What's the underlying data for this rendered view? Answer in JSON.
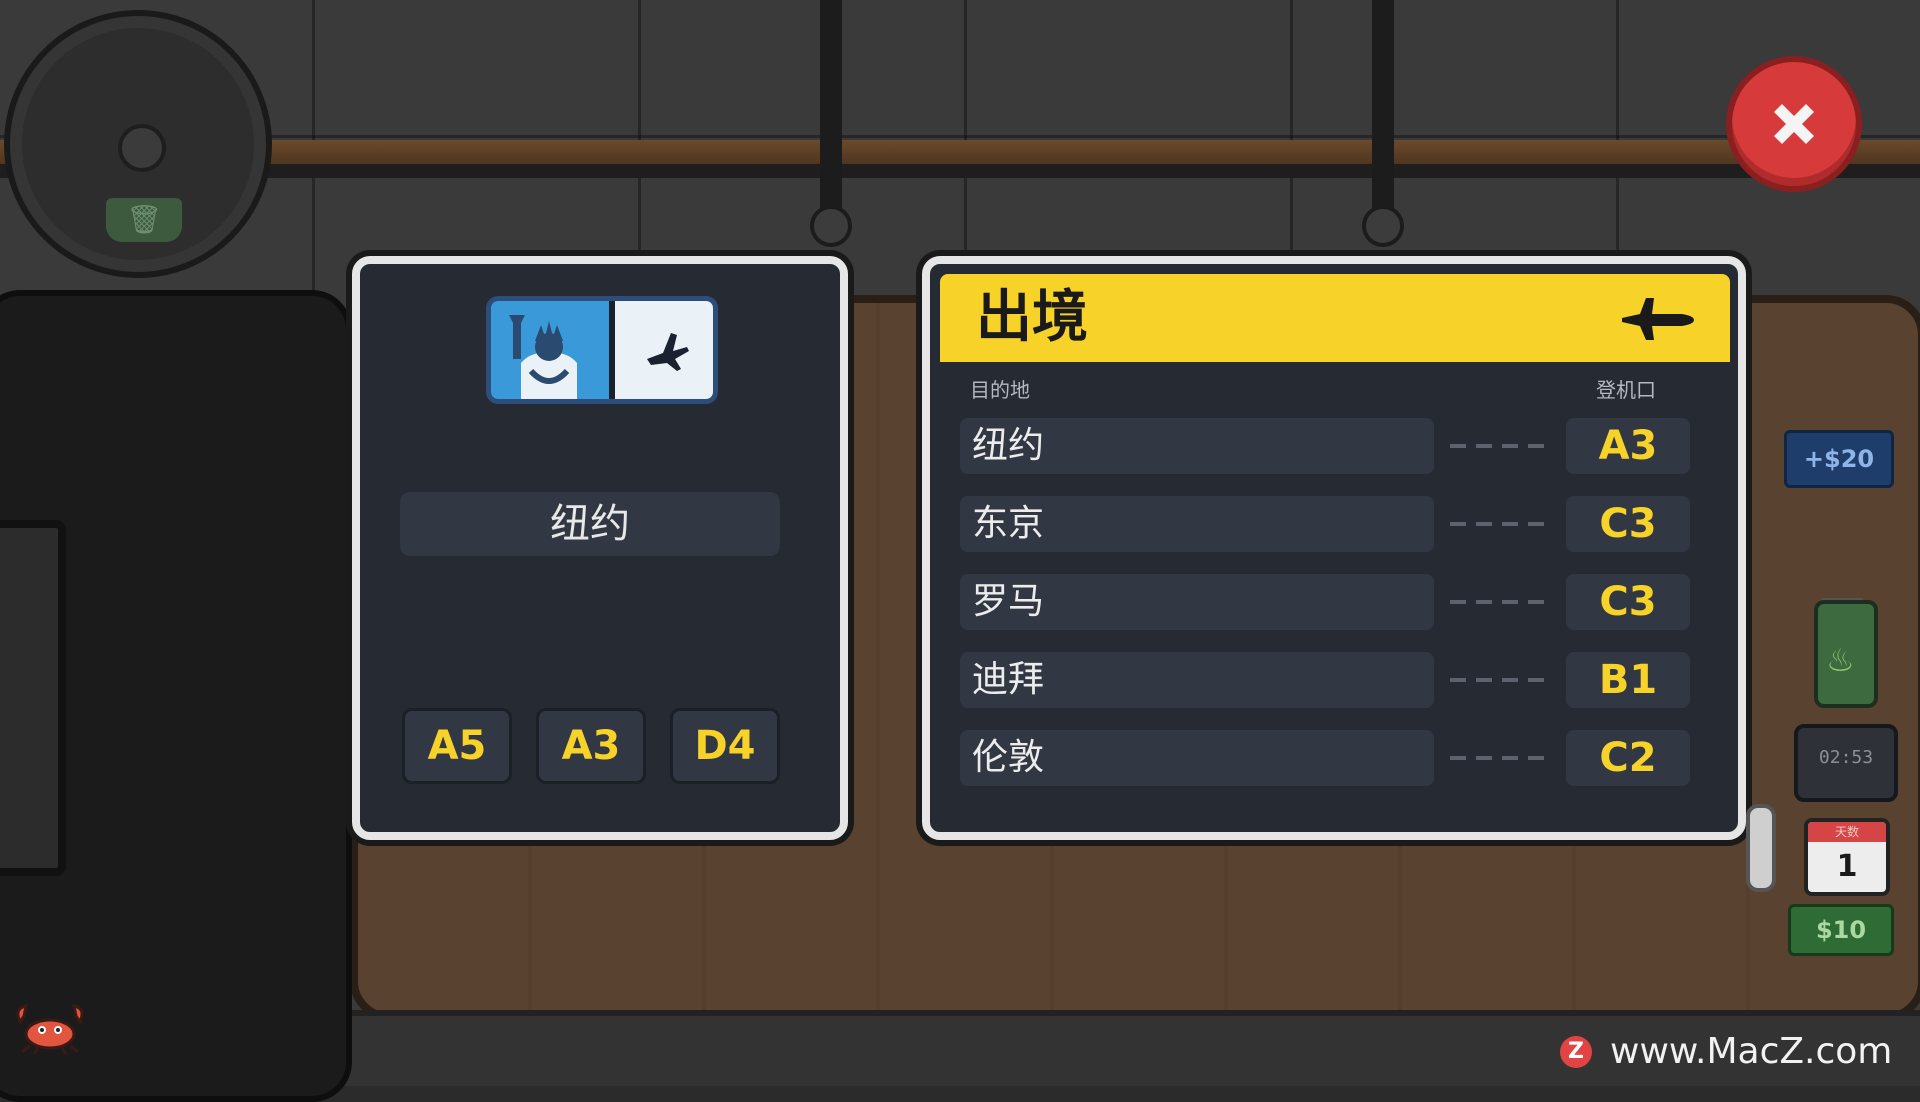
{
  "ticket": {
    "destination": "纽约",
    "gate_options": [
      "A5",
      "A3",
      "D4"
    ]
  },
  "board": {
    "title": "出境",
    "destination_header": "目的地",
    "gate_header": "登机口",
    "flights": [
      {
        "city": "纽约",
        "gate": "A3"
      },
      {
        "city": "东京",
        "gate": "C3"
      },
      {
        "city": "罗马",
        "gate": "C3"
      },
      {
        "city": "迪拜",
        "gate": "B1"
      },
      {
        "city": "伦敦",
        "gate": "C2"
      }
    ]
  },
  "hud": {
    "bonus": "+$20",
    "timer": "02:53",
    "calendar_label": "天数",
    "day": "1",
    "cash": "$10"
  },
  "watermark": {
    "logo": "Z",
    "text": "www.MacZ.com"
  },
  "icons": {
    "close": "close-icon",
    "plane": "airplane-icon",
    "trash": "trash-icon",
    "crab": "crab-icon",
    "statue": "statue-of-liberty-icon",
    "flame": "flame-icon"
  },
  "colors": {
    "accent_yellow": "#f7d229",
    "panel_bg": "#252a33",
    "row_bg": "#323843",
    "close_red": "#d63a3a"
  }
}
